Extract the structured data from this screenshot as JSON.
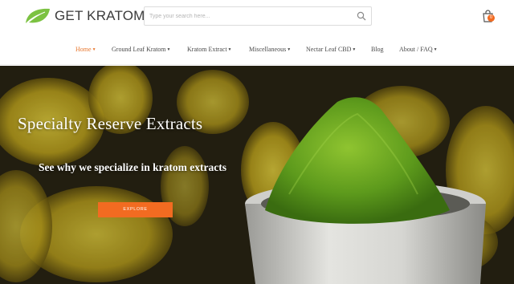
{
  "brand": {
    "name": "GET KRATOM",
    "leaf_color": "#7cc242"
  },
  "search": {
    "placeholder": "Type your search here...",
    "icon": "search-icon"
  },
  "cart": {
    "count": "0",
    "icon": "shopping-bag-icon",
    "badge_color": "#f26b21"
  },
  "nav": {
    "accent_color": "#e8772e",
    "items": [
      {
        "label": "Home",
        "dropdown": true,
        "active": true
      },
      {
        "label": "Ground Leaf Kratom",
        "dropdown": true
      },
      {
        "label": "Kratom Extract",
        "dropdown": true
      },
      {
        "label": "Miscellaneous",
        "dropdown": true
      },
      {
        "label": "Nectar Leaf CBD",
        "dropdown": true
      },
      {
        "label": "Blog",
        "dropdown": false
      },
      {
        "label": "About / FAQ",
        "dropdown": true
      }
    ]
  },
  "hero": {
    "title": "Specialty Reserve Extracts",
    "subtitle": "See why we specialize in kratom extracts",
    "cta": "EXPLORE",
    "cta_color": "#f26b21"
  }
}
